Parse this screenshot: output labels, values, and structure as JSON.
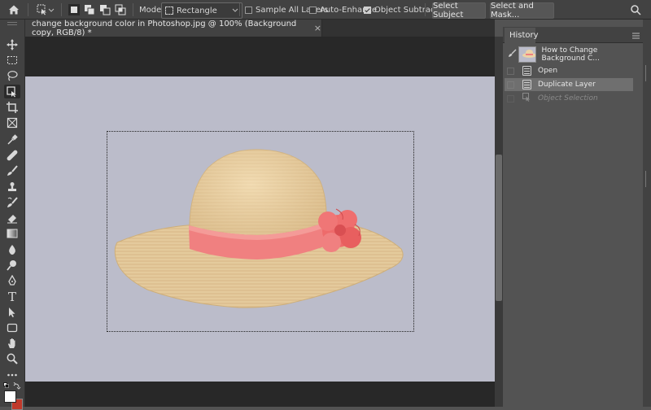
{
  "options_bar": {
    "mode_label": "Mode:",
    "mode_value": "Rectangle",
    "sample_all_layers": {
      "label": "Sample All Layers",
      "checked": false
    },
    "auto_enhance": {
      "label": "Auto-Enhance",
      "checked": false
    },
    "object_subtract": {
      "label": "Object Subtract",
      "checked": true
    },
    "select_subject_label": "Select Subject",
    "select_and_mask_label": "Select and Mask..."
  },
  "document_tab": {
    "title": "change background color in Photoshop.jpg @ 100% (Background copy, RGB/8) *",
    "close": "×"
  },
  "history": {
    "tab_label": "History",
    "snapshot_label": "How to Change Background C...",
    "states": [
      {
        "label": "Open",
        "state": "normal"
      },
      {
        "label": "Duplicate Layer",
        "state": "selected"
      },
      {
        "label": "Object Selection",
        "state": "dimmed"
      }
    ]
  },
  "canvas": {
    "background_color": "#bbbcca",
    "hat_band_color": "#f08080",
    "straw_color": "#ecd3a6"
  },
  "toolbar": {
    "tools": [
      "move-icon",
      "marquee-icon",
      "lasso-icon",
      "object-selection-icon",
      "crop-icon",
      "frame-icon",
      "eyedropper-icon",
      "healing-brush-icon",
      "brush-icon",
      "clone-stamp-icon",
      "history-brush-icon",
      "eraser-icon",
      "gradient-icon",
      "blur-icon",
      "dodge-icon",
      "pen-icon",
      "type-icon",
      "path-selection-icon",
      "rectangle-icon",
      "hand-icon",
      "zoom-icon",
      "more-icon"
    ],
    "type_tool_glyph": "T"
  }
}
